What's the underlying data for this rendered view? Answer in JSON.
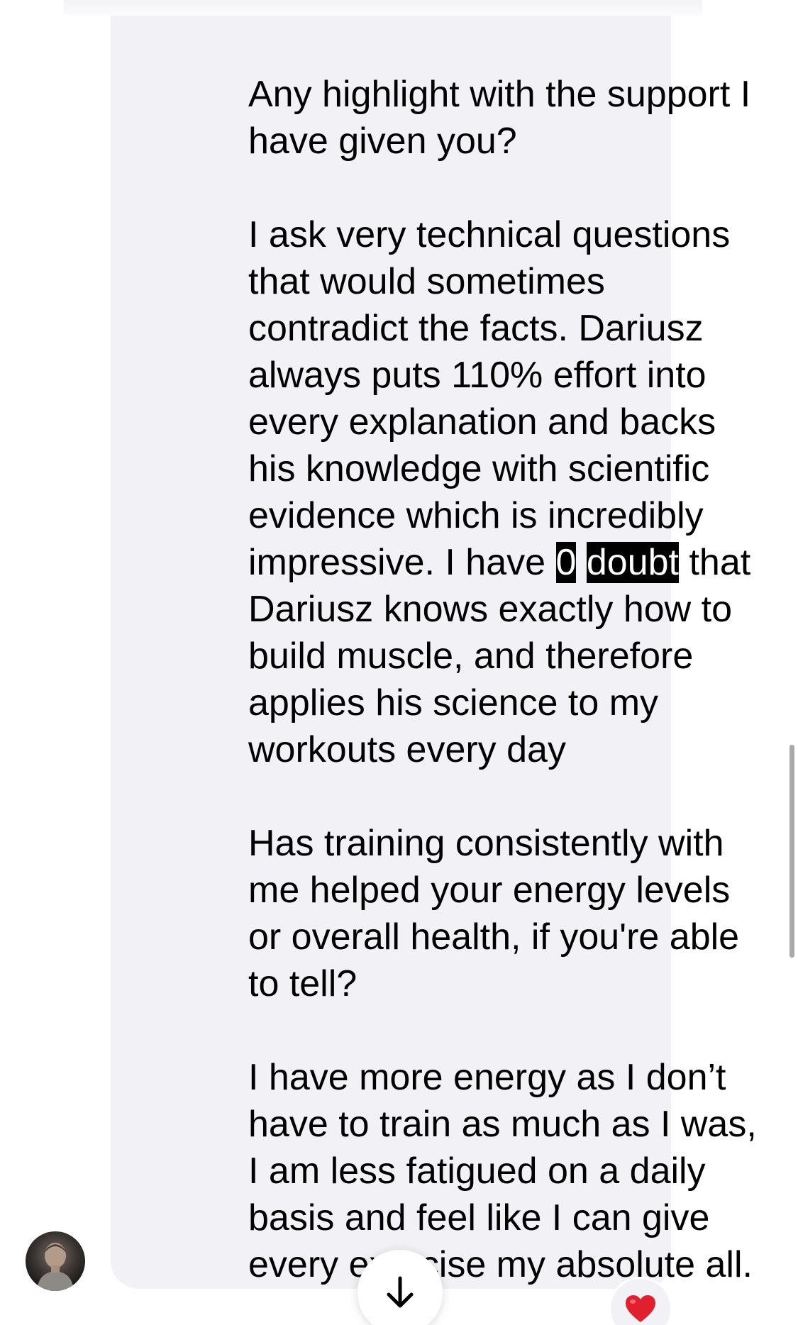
{
  "conversation": {
    "message": {
      "paragraph_1": "Any highlight with the support I have given you?",
      "paragraph_2_before": "I ask very technical questions that would sometimes contradict the facts. Dariusz always puts 110% effort into every explanation and backs his knowledge with scientific evidence which is incredibly impressive. I have ",
      "highlight_1": "0",
      "highlight_2": "doubt",
      "paragraph_2_after": " that Dariusz knows exactly how to build muscle, and therefore applies his science to my workouts every day",
      "paragraph_3": "Has training consistently with me helped your energy levels or overall health, if you're able to tell?",
      "paragraph_4": "I have more energy as I don’t have to train as much as I was, I am less fatigued on a daily basis and feel like I can give every exercise my absolute all."
    },
    "reaction": {
      "icon": "red-heart-icon",
      "color": "#e0202e"
    },
    "scroll_button_icon": "arrow-down-icon",
    "avatar_icon": "profile-avatar"
  }
}
